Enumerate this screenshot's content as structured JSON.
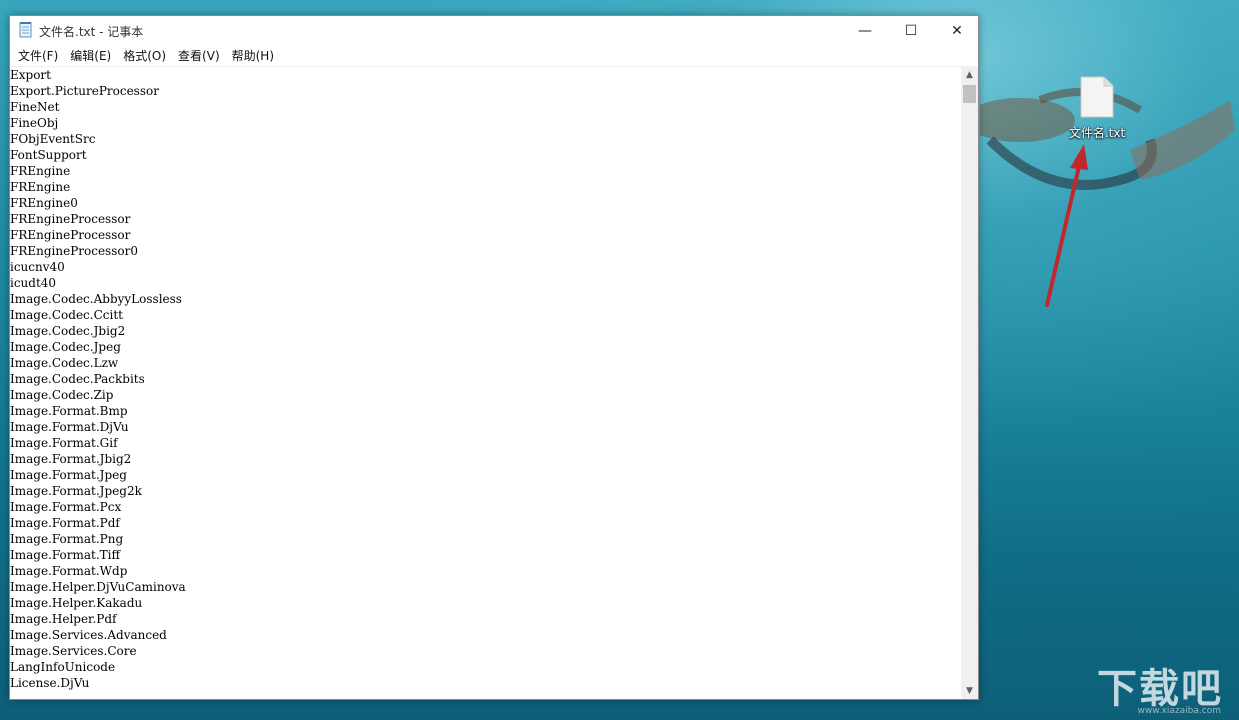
{
  "window": {
    "title": "文件名.txt - 记事本",
    "controls": {
      "minimize": "—",
      "maximize": "☐",
      "close": "✕"
    }
  },
  "menu": [
    {
      "label": "文件(F)"
    },
    {
      "label": "编辑(E)"
    },
    {
      "label": "格式(O)"
    },
    {
      "label": "查看(V)"
    },
    {
      "label": "帮助(H)"
    }
  ],
  "editor": {
    "lines": [
      "Export",
      "Export.PictureProcessor",
      "FineNet",
      "FineObj",
      "FObjEventSrc",
      "FontSupport",
      "FREngine",
      "FREngine",
      "FREngine0",
      "FREngineProcessor",
      "FREngineProcessor",
      "FREngineProcessor0",
      "icucnv40",
      "icudt40",
      "Image.Codec.AbbyyLossless",
      "Image.Codec.Ccitt",
      "Image.Codec.Jbig2",
      "Image.Codec.Jpeg",
      "Image.Codec.Lzw",
      "Image.Codec.Packbits",
      "Image.Codec.Zip",
      "Image.Format.Bmp",
      "Image.Format.DjVu",
      "Image.Format.Gif",
      "Image.Format.Jbig2",
      "Image.Format.Jpeg",
      "Image.Format.Jpeg2k",
      "Image.Format.Pcx",
      "Image.Format.Pdf",
      "Image.Format.Png",
      "Image.Format.Tiff",
      "Image.Format.Wdp",
      "Image.Helper.DjVuCaminova",
      "Image.Helper.Kakadu",
      "Image.Helper.Pdf",
      "Image.Services.Advanced",
      "Image.Services.Core",
      "LangInfoUnicode",
      "License.DjVu"
    ]
  },
  "scrollbar": {
    "up": "▲",
    "down": "▼"
  },
  "desktop": {
    "icon_label": "文件名.txt",
    "watermark": "下载吧",
    "watermark_url": "www.xiazaiba.com"
  },
  "colors": {
    "arrow": "#c0282d",
    "desktop_bg": "#1f8aa3"
  }
}
